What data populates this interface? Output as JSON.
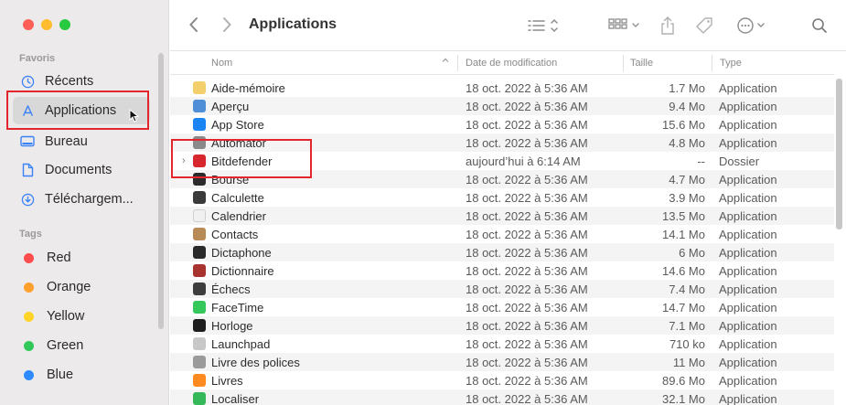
{
  "toolbar": {
    "title": "Applications",
    "back_icon": "chevron-left-icon",
    "forward_icon": "chevron-right-icon"
  },
  "sidebar": {
    "favorites_heading": "Favoris",
    "favorites": [
      {
        "label": "Récents",
        "icon": "clock-icon"
      },
      {
        "label": "Applications",
        "icon": "applications-icon"
      },
      {
        "label": "Bureau",
        "icon": "desktop-icon"
      },
      {
        "label": "Documents",
        "icon": "document-icon"
      },
      {
        "label": "Téléchargem...",
        "icon": "download-icon"
      }
    ],
    "tags_heading": "Tags",
    "tags": [
      {
        "label": "Red",
        "color": "#ff4d4d"
      },
      {
        "label": "Orange",
        "color": "#ff9f2e"
      },
      {
        "label": "Yellow",
        "color": "#ffd426"
      },
      {
        "label": "Green",
        "color": "#31c85a"
      },
      {
        "label": "Blue",
        "color": "#2e8bff"
      }
    ]
  },
  "columns": {
    "name": "Nom",
    "date": "Date de modification",
    "size": "Taille",
    "kind": "Type"
  },
  "rows": [
    {
      "name": "Aide-mémoire",
      "date": "18 oct. 2022 à 5:36 AM",
      "size": "1.7 Mo",
      "kind": "Application",
      "color": "#f2cf6a"
    },
    {
      "name": "Aperçu",
      "date": "18 oct. 2022 à 5:36 AM",
      "size": "9.4 Mo",
      "kind": "Application",
      "color": "#4f8fd8"
    },
    {
      "name": "App Store",
      "date": "18 oct. 2022 à 5:36 AM",
      "size": "15.6 Mo",
      "kind": "Application",
      "color": "#1a84f2"
    },
    {
      "name": "Automator",
      "date": "18 oct. 2022 à 5:36 AM",
      "size": "4.8 Mo",
      "kind": "Application",
      "color": "#8a8a8a"
    },
    {
      "name": "Bitdefender",
      "date": "aujourd’hui à 6:14 AM",
      "size": "--",
      "kind": "Dossier",
      "color": "#d8262e",
      "disclosure": "›"
    },
    {
      "name": "Bourse",
      "date": "18 oct. 2022 à 5:36 AM",
      "size": "4.7 Mo",
      "kind": "Application",
      "color": "#2b2b2b"
    },
    {
      "name": "Calculette",
      "date": "18 oct. 2022 à 5:36 AM",
      "size": "3.9 Mo",
      "kind": "Application",
      "color": "#3a3a3a"
    },
    {
      "name": "Calendrier",
      "date": "18 oct. 2022 à 5:36 AM",
      "size": "13.5 Mo",
      "kind": "Application",
      "color": "#f0f0f0"
    },
    {
      "name": "Contacts",
      "date": "18 oct. 2022 à 5:36 AM",
      "size": "14.1 Mo",
      "kind": "Application",
      "color": "#b88a56"
    },
    {
      "name": "Dictaphone",
      "date": "18 oct. 2022 à 5:36 AM",
      "size": "6 Mo",
      "kind": "Application",
      "color": "#2a2a2a"
    },
    {
      "name": "Dictionnaire",
      "date": "18 oct. 2022 à 5:36 AM",
      "size": "14.6 Mo",
      "kind": "Application",
      "color": "#a8322d"
    },
    {
      "name": "Échecs",
      "date": "18 oct. 2022 à 5:36 AM",
      "size": "7.4 Mo",
      "kind": "Application",
      "color": "#3d3d3d"
    },
    {
      "name": "FaceTime",
      "date": "18 oct. 2022 à 5:36 AM",
      "size": "14.7 Mo",
      "kind": "Application",
      "color": "#34c759"
    },
    {
      "name": "Horloge",
      "date": "18 oct. 2022 à 5:36 AM",
      "size": "7.1 Mo",
      "kind": "Application",
      "color": "#1e1e1e"
    },
    {
      "name": "Launchpad",
      "date": "18 oct. 2022 à 5:36 AM",
      "size": "710 ko",
      "kind": "Application",
      "color": "#c8c8c8"
    },
    {
      "name": "Livre des polices",
      "date": "18 oct. 2022 à 5:36 AM",
      "size": "11 Mo",
      "kind": "Application",
      "color": "#9a9a9a"
    },
    {
      "name": "Livres",
      "date": "18 oct. 2022 à 5:36 AM",
      "size": "89.6 Mo",
      "kind": "Application",
      "color": "#ff8a1f"
    },
    {
      "name": "Localiser",
      "date": "18 oct. 2022 à 5:36 AM",
      "size": "32.1 Mo",
      "kind": "Application",
      "color": "#34b85a"
    }
  ]
}
